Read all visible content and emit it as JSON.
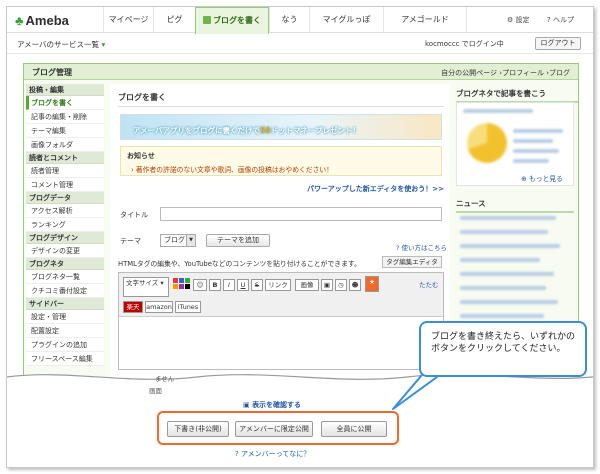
{
  "header": {
    "logo": "Ameba",
    "nav": [
      "マイページ",
      "ピグ",
      "ブログを書く",
      "なう",
      "マイグルっぽ",
      "アメゴールド"
    ],
    "settings": "設定",
    "help": "ヘルプ"
  },
  "subbar": {
    "services": "アメーバのサービス一覧",
    "login_status": "kocmoccc でログイン中",
    "logout": "ログアウト"
  },
  "panel": {
    "title": "ブログ管理",
    "links": [
      "自分の公開ページ",
      "プロフィール",
      "ブログ"
    ]
  },
  "sidebar": [
    {
      "category": "投稿・編集",
      "items": [
        "ブログを書く",
        "記事の編集・削除",
        "テーマ編集",
        "画像フォルダ"
      ]
    },
    {
      "category": "読者とコメント",
      "items": [
        "読者管理",
        "コメント管理"
      ]
    },
    {
      "category": "ブログデータ",
      "items": [
        "アクセス解析",
        "ランキング"
      ]
    },
    {
      "category": "ブログデザイン",
      "items": [
        "デザインの変更"
      ]
    },
    {
      "category": "ブログネタ",
      "items": [
        "ブログネタ一覧",
        "クチコミ番付設定"
      ]
    },
    {
      "category": "サイドバー",
      "items": [
        "設定・管理",
        "配置設定",
        "プラグインの追加",
        "フリースペース編集"
      ]
    }
  ],
  "main": {
    "heading": "ブログを書く",
    "banner": {
      "pre": "アメーバアプリをブログに書くだけで",
      "num": "50",
      "post": "ドットマネープレゼント!"
    },
    "notice": {
      "title": "お知らせ",
      "message": "著作者の許諾のない文章や歌詞、画像の投稿はおやめください！"
    },
    "power_editor": "パワーアップした新エディタを使おう！>>",
    "title_label": "タイトル",
    "theme_label": "テーマ",
    "theme_value": "ブログ",
    "add_theme": "テーマを追加",
    "usage": "使い方はこちら",
    "html_note": "HTMLタグの編集や、YouTubeなどのコンテンツを貼り付けることができます。",
    "tag_edit": "タグ編集エディタ",
    "toolbar": {
      "font_size": "文字サイズ",
      "buttons": [
        "B",
        "I",
        "U",
        "S",
        "リンク",
        "画像"
      ],
      "close": "たたむ",
      "row2": [
        "楽天",
        "amazon",
        "iTunes"
      ]
    },
    "fragments": [
      "ません",
      "画面"
    ],
    "confirm_link": "表示を確認する"
  },
  "right": {
    "neta_heading": "ブログネタで記事を書こう",
    "more": "もっと見る",
    "news_heading": "ニュース"
  },
  "actions": {
    "draft": "下書き(非公開)",
    "members": "アメンバーに限定公開",
    "publish": "全員に公開",
    "what_is": "アメンバーってなに？"
  },
  "callout": {
    "text": "ブログを書き終えたら、いずれかのボタンをクリックしてください。"
  },
  "colors": {
    "accent_green": "#6fb34a",
    "highlight_orange": "#ee6a2b",
    "callout_blue": "#3b8ed6",
    "link_blue": "#2257a8"
  }
}
